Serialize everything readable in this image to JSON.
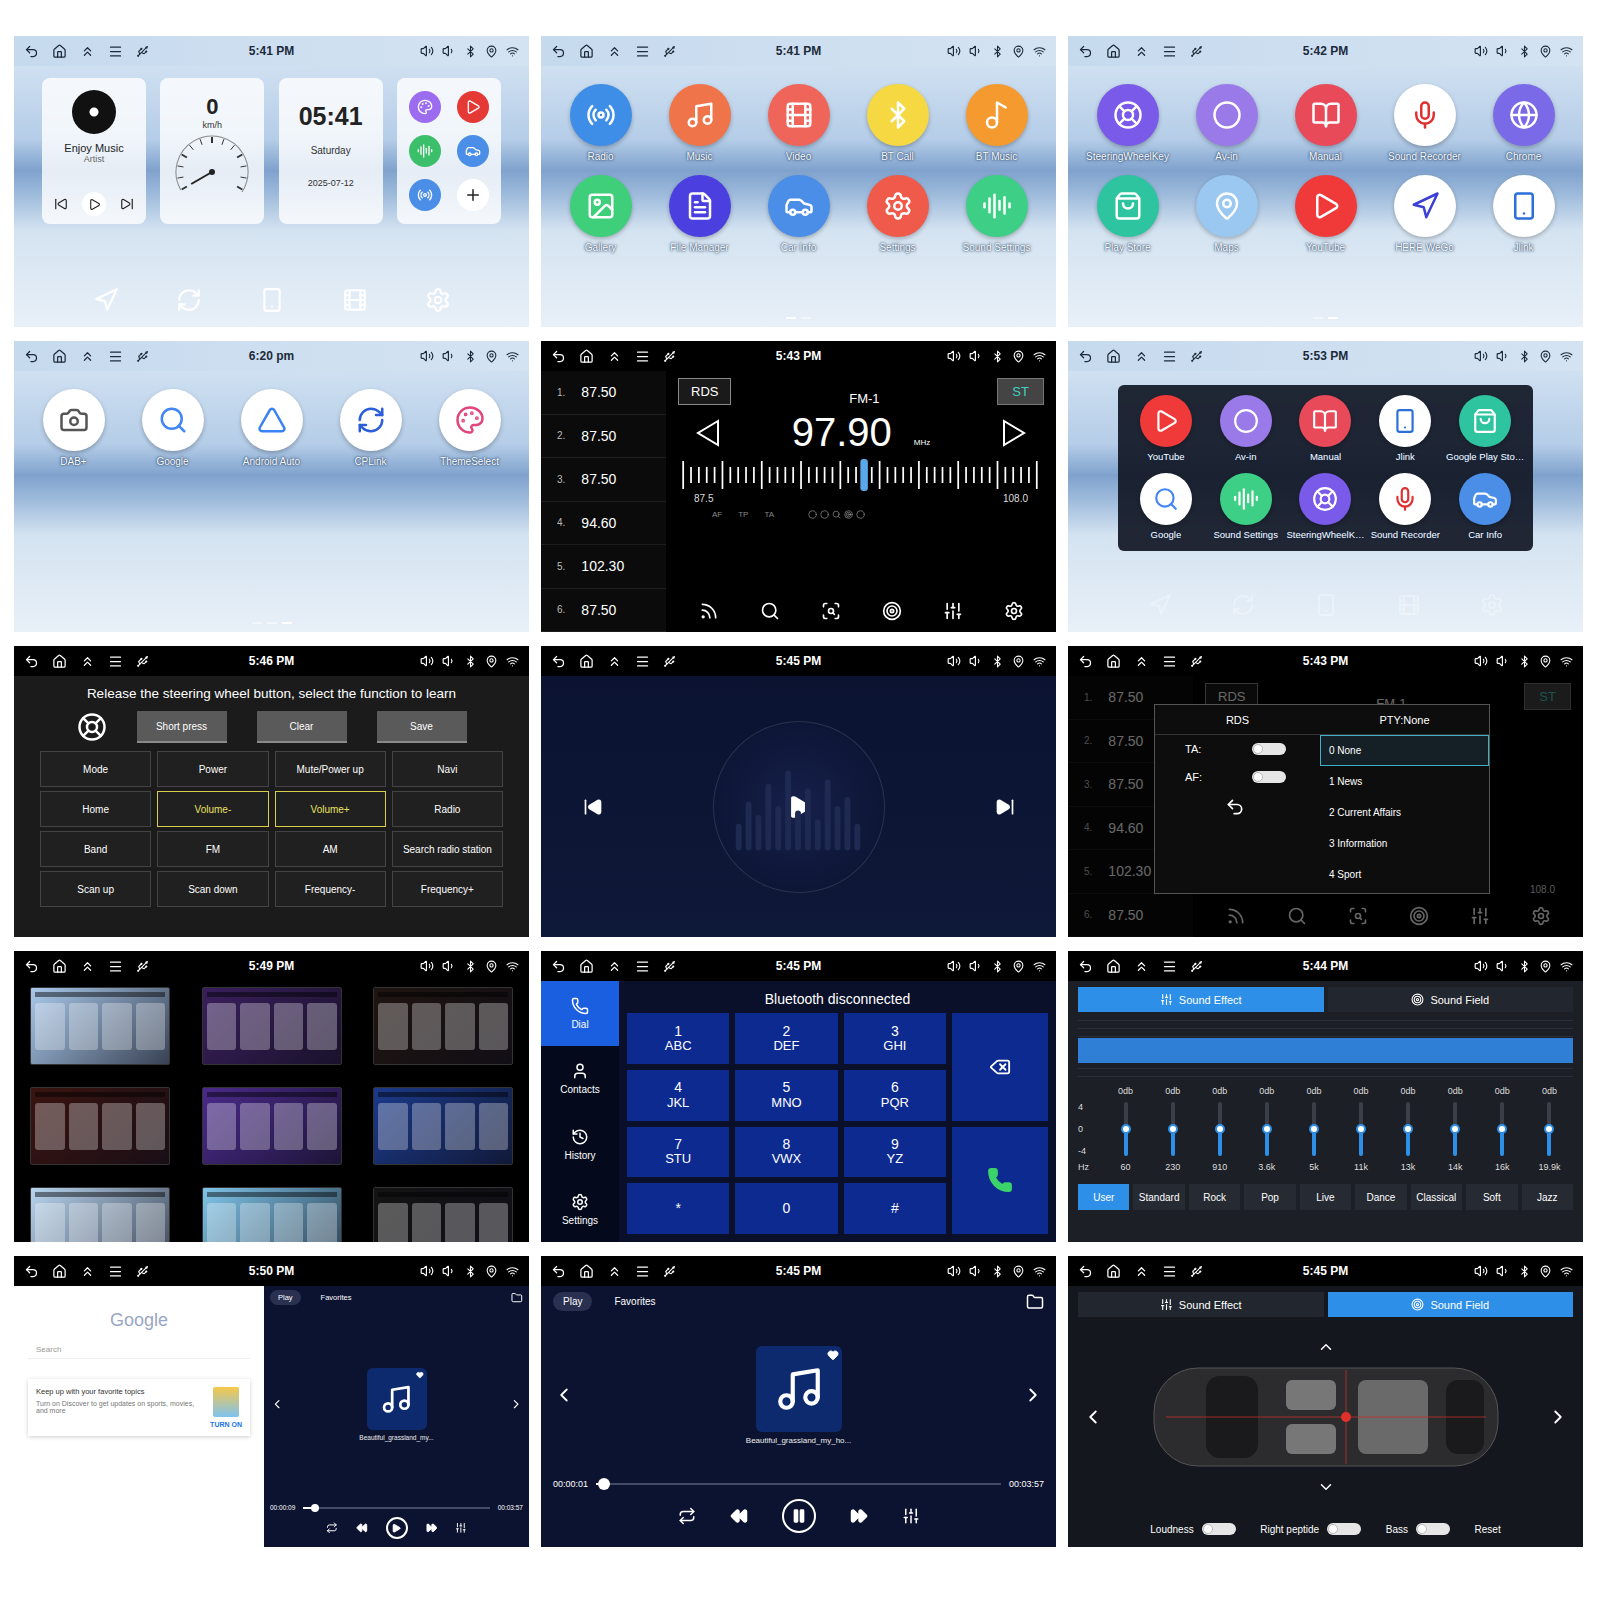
{
  "panels": [
    {
      "kind": "home",
      "time": "5:41 PM",
      "music": {
        "title": "Enjoy Music",
        "artist": "Artist"
      },
      "speed": {
        "value": "0",
        "unit": "km/h",
        "level": 0
      },
      "clock": {
        "time": "05:41",
        "day": "Saturday",
        "date": "2025-07-12"
      },
      "shortcuts": [
        {
          "color": "#9b6cf0"
        },
        {
          "color": "#e53935"
        },
        {
          "color": "#3cbf6a"
        },
        {
          "color": "#4a8ee8"
        },
        {
          "color": "#4a8ee8"
        }
      ]
    },
    {
      "kind": "apps",
      "time": "5:41 PM",
      "apps": [
        {
          "label": "Radio",
          "color": "#3e8ee8",
          "ink": "#ffffff"
        },
        {
          "label": "Music",
          "color": "#f0744a",
          "ink": "#ffffff"
        },
        {
          "label": "Video",
          "color": "#f0655a",
          "ink": "#ffffff"
        },
        {
          "label": "BT Call",
          "color": "#f5d842",
          "ink": "#ffffff"
        },
        {
          "label": "BT Music",
          "color": "#f59a2e",
          "ink": "#ffffff"
        },
        {
          "label": "Gallery",
          "color": "#3fcf7a",
          "ink": "#ffffff"
        },
        {
          "label": "File Manager",
          "color": "#4b3fe0",
          "ink": "#ffffff"
        },
        {
          "label": "Car Info",
          "color": "#4a8ee8",
          "ink": "#ffffff"
        },
        {
          "label": "Settings",
          "color": "#f05a4a",
          "ink": "#ffffff"
        },
        {
          "label": "Sound Settings",
          "color": "#3ecf86",
          "ink": "#ffffff"
        }
      ],
      "pages": [
        {
          "selected": true
        },
        {
          "selected": false
        }
      ]
    },
    {
      "kind": "apps",
      "time": "5:42 PM",
      "apps": [
        {
          "label": "SteeringWheelKey",
          "color": "#7a5ae8",
          "ink": "#ffffff"
        },
        {
          "label": "Av-in",
          "color": "#9a7ae8",
          "ink": "#ffffff"
        },
        {
          "label": "Manual",
          "color": "#e84a5a",
          "ink": "#ffffff"
        },
        {
          "label": "Sound Recorder",
          "color": "#ffffff",
          "ink": "#e03030"
        },
        {
          "label": "Chrome",
          "color": "#7a6ae8",
          "ink": "#ffffff"
        },
        {
          "label": "Play Store",
          "color": "#2ec4a0",
          "ink": "#ffffff"
        },
        {
          "label": "Maps",
          "color": "#9ac8f0",
          "ink": "#ffffff"
        },
        {
          "label": "YouTube",
          "color": "#f03a3a",
          "ink": "#ffffff"
        },
        {
          "label": "HERE WeGo",
          "color": "#ffffff",
          "ink": "#3b3fd8"
        },
        {
          "label": "Jlink",
          "color": "#ffffff",
          "ink": "#2b6fd9"
        }
      ],
      "pages": [
        {
          "selected": false
        },
        {
          "selected": true
        }
      ]
    },
    {
      "kind": "apps",
      "time": "6:20 pm",
      "apps": [
        {
          "label": "DAB+",
          "color": "#ffffff",
          "ink": "#555555"
        },
        {
          "label": "Google",
          "color": "#ffffff",
          "ink": "#4285f4"
        },
        {
          "label": "Android Auto",
          "color": "#ffffff",
          "ink": "#3b82f6"
        },
        {
          "label": "CPLink",
          "color": "#ffffff",
          "ink": "#2b5fd9"
        },
        {
          "label": "ThemeSelect",
          "color": "#ffffff",
          "ink": "#e0457b"
        }
      ],
      "pages": [
        {
          "selected": false
        },
        {
          "selected": false
        },
        {
          "selected": true
        }
      ]
    },
    {
      "kind": "radio",
      "time": "5:43 PM",
      "presets": [
        {
          "num": "1.",
          "freq": "87.50"
        },
        {
          "num": "2.",
          "freq": "87.50"
        },
        {
          "num": "3.",
          "freq": "87.50"
        },
        {
          "num": "4.",
          "freq": "94.60"
        },
        {
          "num": "5.",
          "freq": "102.30"
        },
        {
          "num": "6.",
          "freq": "87.50"
        }
      ],
      "rds": "RDS",
      "band": "FM-1",
      "stereo": "ST",
      "freq": "97.90",
      "unit": "MHz",
      "min": "87.5",
      "max": "108.0",
      "level": 0.507,
      "flags": [
        "AF",
        "TP",
        "TA"
      ]
    },
    {
      "kind": "drawer",
      "time": "5:53 PM",
      "apps": [
        {
          "label": "YouTube",
          "color": "#f03a3a",
          "ink": "#ffffff"
        },
        {
          "label": "Av-in",
          "color": "#9a7ae8",
          "ink": "#ffffff"
        },
        {
          "label": "Manual",
          "color": "#e84a5a",
          "ink": "#ffffff"
        },
        {
          "label": "Jlink",
          "color": "#ffffff",
          "ink": "#2b6fd9"
        },
        {
          "label": "Google Play Sto…",
          "color": "#2ec4a0",
          "ink": "#ffffff"
        },
        {
          "label": "Google",
          "color": "#ffffff",
          "ink": "#4285f4"
        },
        {
          "label": "Sound Settings",
          "color": "#3ecf86",
          "ink": "#ffffff"
        },
        {
          "label": "SteeringWheelK…",
          "color": "#7a5ae8",
          "ink": "#ffffff"
        },
        {
          "label": "Sound Recorder",
          "color": "#ffffff",
          "ink": "#e03030"
        },
        {
          "label": "Car Info",
          "color": "#4a8ee8",
          "ink": "#ffffff"
        }
      ]
    },
    {
      "kind": "steering",
      "time": "5:46 PM",
      "prompt": "Release the steering wheel button, select the function to learn",
      "actions": [
        "Short press",
        "Clear",
        "Save"
      ],
      "keys": [
        {
          "label": "Mode",
          "selected": false
        },
        {
          "label": "Power",
          "selected": false
        },
        {
          "label": "Mute/Power up",
          "selected": false
        },
        {
          "label": "Navi",
          "selected": false
        },
        {
          "label": "Home",
          "selected": false
        },
        {
          "label": "Volume-",
          "selected": true
        },
        {
          "label": "Volume+",
          "selected": true
        },
        {
          "label": "Radio",
          "selected": false
        },
        {
          "label": "Band",
          "selected": false
        },
        {
          "label": "FM",
          "selected": false
        },
        {
          "label": "AM",
          "selected": false
        },
        {
          "label": "Search radio station",
          "selected": false
        },
        {
          "label": "Scan up",
          "selected": false
        },
        {
          "label": "Scan down",
          "selected": false
        },
        {
          "label": "Frequency-",
          "selected": false
        },
        {
          "label": "Frequency+",
          "selected": false
        }
      ]
    },
    {
      "kind": "video",
      "time": "5:45 PM",
      "playing": false
    },
    {
      "kind": "rds",
      "time": "5:43 PM",
      "background": {
        "presets": [
          {
            "num": "1.",
            "freq": "87.50"
          },
          {
            "num": "2.",
            "freq": "87.50"
          },
          {
            "num": "3.",
            "freq": "87.50"
          },
          {
            "num": "4.",
            "freq": "94.60"
          },
          {
            "num": "5.",
            "freq": "102.30"
          },
          {
            "num": "6.",
            "freq": "87.50"
          }
        ],
        "rds": "RDS",
        "band": "FM-1",
        "stereo": "ST",
        "max": "108.0"
      },
      "dialog": {
        "title": "RDS",
        "pty": "PTY:None",
        "toggles": [
          {
            "label": "TA:",
            "on": false
          },
          {
            "label": "AF:",
            "on": false
          }
        ],
        "options": [
          {
            "label": "0 None",
            "selected": true
          },
          {
            "label": "1 News",
            "selected": false
          },
          {
            "label": "2 Current Affairs",
            "selected": false
          },
          {
            "label": "3 Information",
            "selected": false
          },
          {
            "label": "4 Sport",
            "selected": false
          }
        ]
      }
    },
    {
      "kind": "themes",
      "time": "5:49 PM",
      "themes": [
        {
          "color": "#a9c8ea"
        },
        {
          "color": "#3a1f5c"
        },
        {
          "color": "#1f1410"
        },
        {
          "color": "#3a1410"
        },
        {
          "color": "#4a2a8a"
        },
        {
          "color": "#1c3a8a"
        },
        {
          "color": "#b8d4ee"
        },
        {
          "color": "#7fc4e8"
        },
        {
          "color": "#141414"
        }
      ]
    },
    {
      "kind": "dialer",
      "time": "5:45 PM",
      "nav": [
        {
          "label": "Dial",
          "selected": true
        },
        {
          "label": "Contacts",
          "selected": false
        },
        {
          "label": "History",
          "selected": false
        },
        {
          "label": "Settings",
          "selected": false
        }
      ],
      "status": "Bluetooth disconnected",
      "keys": [
        {
          "digit": "1",
          "letters": "ABC"
        },
        {
          "digit": "2",
          "letters": "DEF"
        },
        {
          "digit": "3",
          "letters": "GHI"
        },
        {
          "digit": "4",
          "letters": "JKL"
        },
        {
          "digit": "5",
          "letters": "MNO"
        },
        {
          "digit": "6",
          "letters": "PQR"
        },
        {
          "digit": "7",
          "letters": "STU"
        },
        {
          "digit": "8",
          "letters": "VWX"
        },
        {
          "digit": "9",
          "letters": "YZ"
        },
        {
          "digit": "*",
          "letters": ""
        },
        {
          "digit": "0",
          "letters": ""
        },
        {
          "digit": "#",
          "letters": ""
        }
      ]
    },
    {
      "kind": "eq",
      "time": "5:44 PM",
      "tabs": [
        {
          "label": "Sound Effect",
          "selected": true
        },
        {
          "label": "Sound Field",
          "selected": false
        }
      ],
      "scale": [
        "4",
        "0",
        "-4"
      ],
      "hz": "Hz",
      "bands": [
        {
          "gain": "0db",
          "freq": "60",
          "level": 0.5
        },
        {
          "gain": "0db",
          "freq": "230",
          "level": 0.5
        },
        {
          "gain": "0db",
          "freq": "910",
          "level": 0.5
        },
        {
          "gain": "0db",
          "freq": "3.6k",
          "level": 0.5
        },
        {
          "gain": "0db",
          "freq": "5k",
          "level": 0.5
        },
        {
          "gain": "0db",
          "freq": "11k",
          "level": 0.5
        },
        {
          "gain": "0db",
          "freq": "13k",
          "level": 0.5
        },
        {
          "gain": "0db",
          "freq": "14k",
          "level": 0.5
        },
        {
          "gain": "0db",
          "freq": "16k",
          "level": 0.5
        },
        {
          "gain": "0db",
          "freq": "19.9k",
          "level": 0.5
        }
      ],
      "presets": [
        {
          "label": "User",
          "selected": true
        },
        {
          "label": "Standard",
          "selected": false
        },
        {
          "label": "Rock",
          "selected": false
        },
        {
          "label": "Pop",
          "selected": false
        },
        {
          "label": "Live",
          "selected": false
        },
        {
          "label": "Dance",
          "selected": false
        },
        {
          "label": "Classical",
          "selected": false
        },
        {
          "label": "Soft",
          "selected": false
        },
        {
          "label": "Jazz",
          "selected": false
        }
      ]
    },
    {
      "kind": "split",
      "time": "5:50 PM",
      "browser": {
        "logo": "Google",
        "search": "Search",
        "card_title": "Keep up with your favorite topics",
        "card_text": "Turn on Discover to get updates on sports, movies, and more",
        "card_button": "TURN ON"
      },
      "player": {
        "tabs": [
          {
            "label": "Play",
            "selected": true
          },
          {
            "label": "Favorites",
            "selected": false
          }
        ],
        "track": "Beautiful_grassland_my...",
        "elapsed": "00:00:09",
        "total": "00:03:57",
        "level": 0.04,
        "playing": false
      }
    },
    {
      "kind": "music",
      "time": "5:45 PM",
      "player": {
        "tabs": [
          {
            "label": "Play",
            "selected": true
          },
          {
            "label": "Favorites",
            "selected": false
          }
        ],
        "track": "Beautiful_grassland_my_ho...",
        "elapsed": "00:00:01",
        "total": "00:03:57",
        "level": 0.005,
        "playing": true
      }
    },
    {
      "kind": "field",
      "time": "5:45 PM",
      "tabs": [
        {
          "label": "Sound Effect",
          "selected": false
        },
        {
          "label": "Sound Field",
          "selected": true
        }
      ],
      "toggles": [
        {
          "label": "Loudness",
          "on": false
        },
        {
          "label": "Right peptide",
          "on": false
        },
        {
          "label": "Bass",
          "on": false
        }
      ],
      "reset": "Reset"
    }
  ]
}
